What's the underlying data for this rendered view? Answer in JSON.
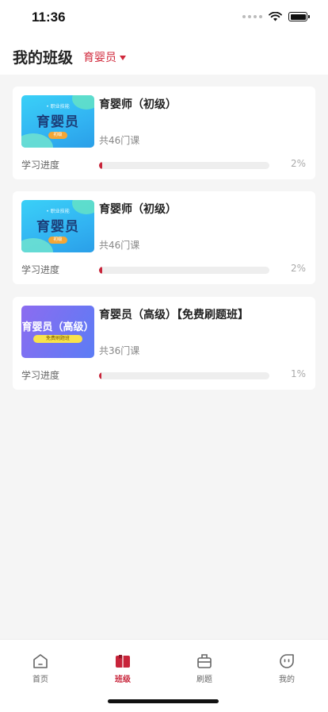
{
  "status_bar": {
    "time": "11:36"
  },
  "header": {
    "title": "我的班级",
    "category": "育婴员"
  },
  "courses": [
    {
      "title": "育婴师（初级）",
      "count": "共46门课",
      "progress_label": "学习进度",
      "progress": 0.02,
      "progress_text": "2%",
      "thumb": {
        "tag": "• 职业技能",
        "title": "育婴员",
        "badge": "初级"
      }
    },
    {
      "title": "育婴师（初级）",
      "count": "共46门课",
      "progress_label": "学习进度",
      "progress": 0.02,
      "progress_text": "2%",
      "thumb": {
        "tag": "• 职业技能",
        "title": "育婴员",
        "badge": "初级"
      }
    },
    {
      "title": "育婴员（高级）【免费刷题班】",
      "count": "共36门课",
      "progress_label": "学习进度",
      "progress": 0.01,
      "progress_text": "1%",
      "thumb": {
        "title": "育婴员（高级）",
        "badge": "免费刷题班"
      }
    }
  ],
  "tabs": [
    {
      "label": "首页",
      "icon": "home-icon",
      "active": false
    },
    {
      "label": "班级",
      "icon": "class-icon",
      "active": true
    },
    {
      "label": "刷题",
      "icon": "practice-icon",
      "active": false
    },
    {
      "label": "我的",
      "icon": "profile-icon",
      "active": false
    }
  ],
  "colors": {
    "accent": "#c8243a",
    "category": "#d0283b"
  }
}
